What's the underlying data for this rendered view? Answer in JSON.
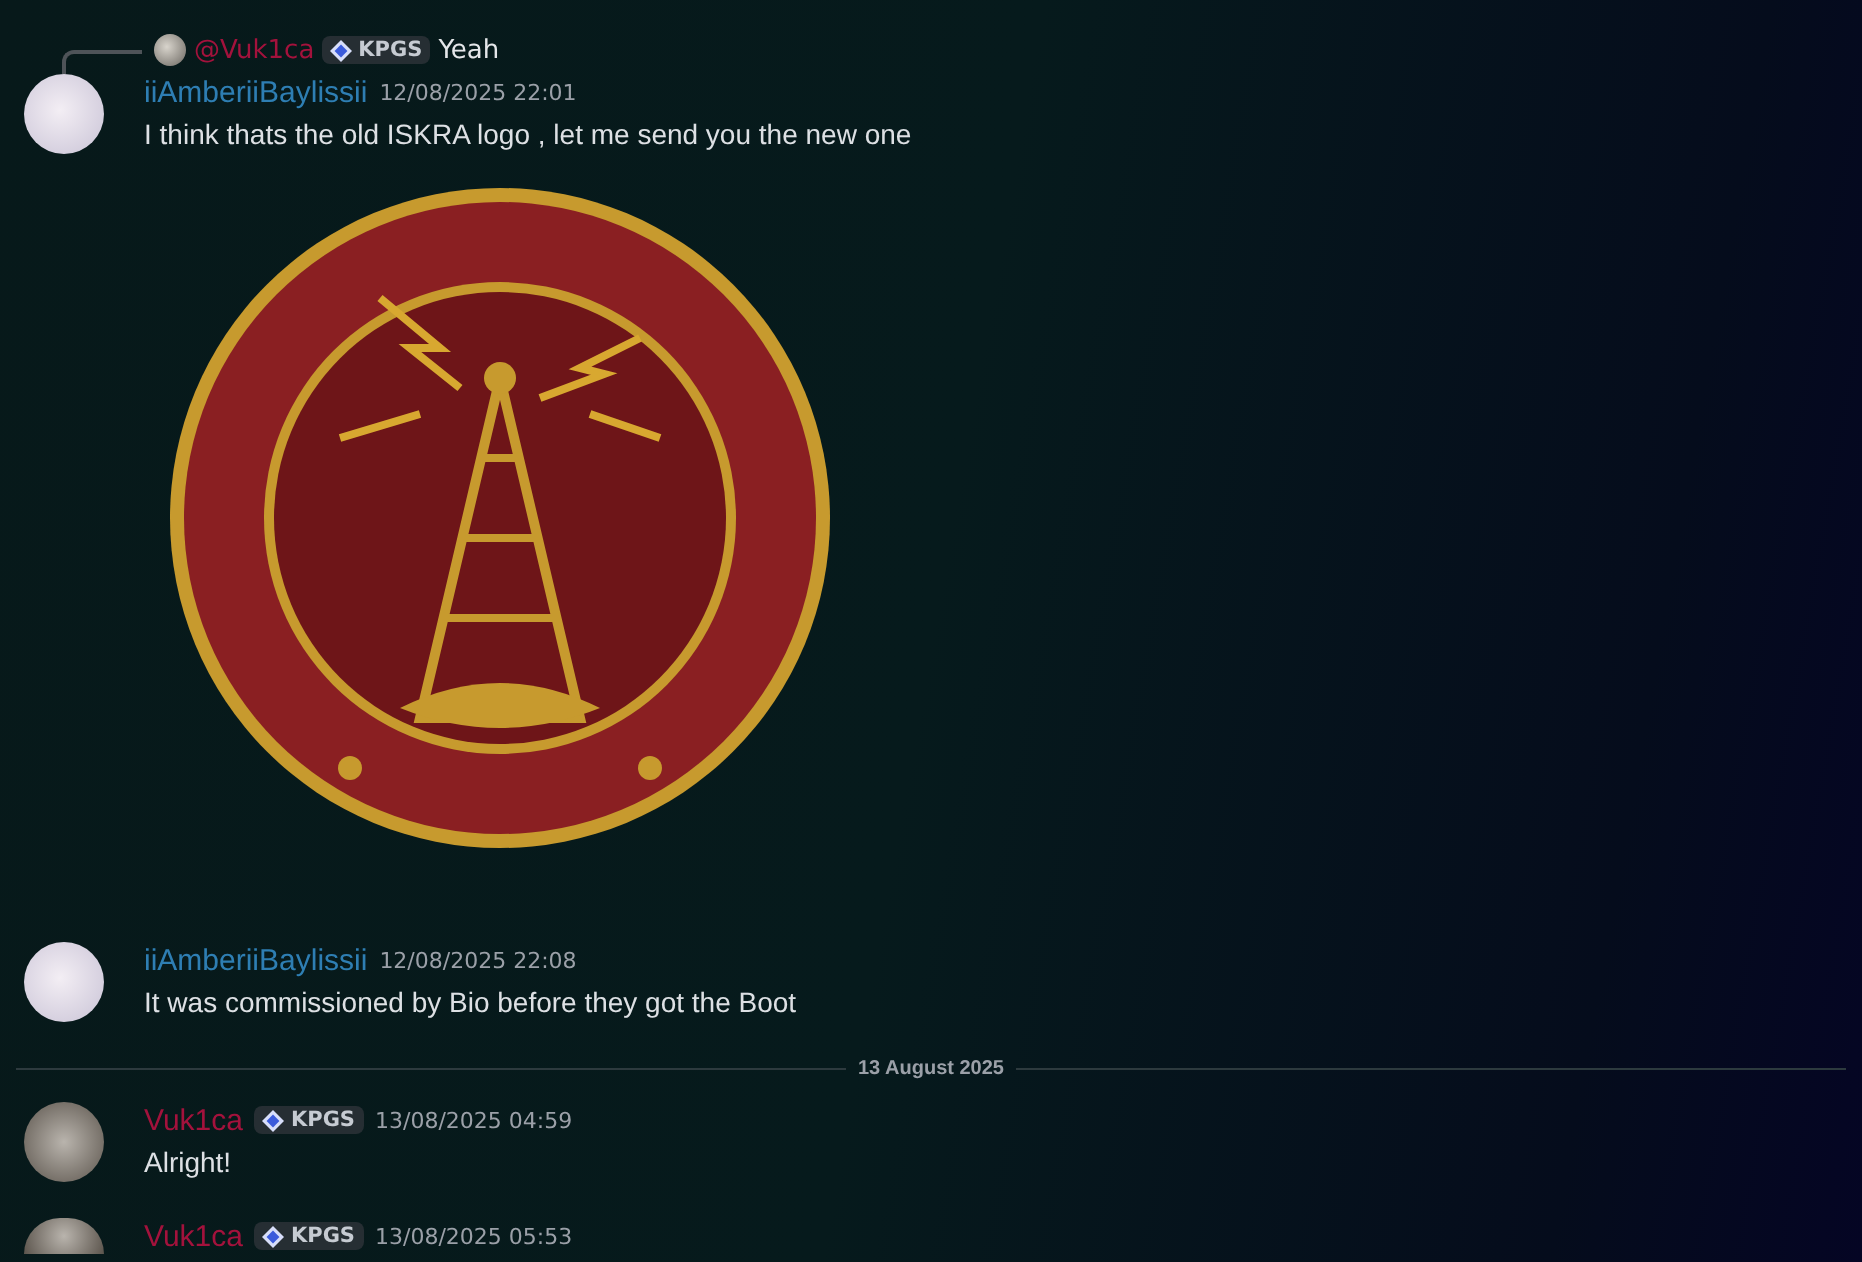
{
  "messages": [
    {
      "kind": "message",
      "author": "iiAmberiiBaylissii",
      "color": "#2e7eb3",
      "timestamp": "12/08/2025 22:01",
      "text": "I think thats the old ISKRA logo , let me send you the new one",
      "reply": {
        "author": "@Vuk1ca",
        "color": "#a3123c",
        "tag": "KPGS",
        "text": "Yeah"
      },
      "attachment": true
    },
    {
      "kind": "message",
      "author": "iiAmberiiBaylissii",
      "color": "#2e7eb3",
      "timestamp": "12/08/2025 22:08",
      "text": "It was commissioned by Bio before they got the Boot"
    },
    {
      "kind": "divider",
      "text": "13 August 2025"
    },
    {
      "kind": "message",
      "author": "Vuk1ca",
      "color": "#a3123c",
      "tag": "KPGS",
      "timestamp": "13/08/2025 04:59",
      "text": "Alright!"
    },
    {
      "kind": "message",
      "author": "Vuk1ca",
      "color": "#a3123c",
      "tag": "KPGS",
      "timestamp": "13/08/2025 05:53"
    }
  ]
}
